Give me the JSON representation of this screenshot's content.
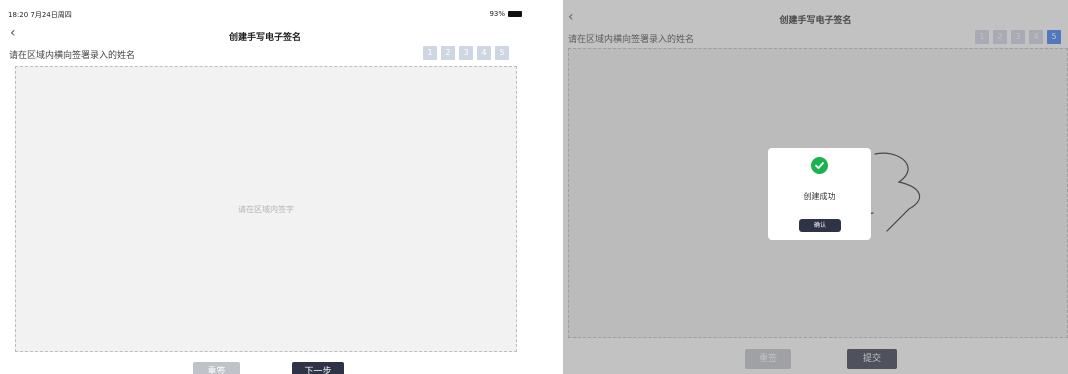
{
  "left": {
    "status_time": "18:20  7月24日周四",
    "battery_pct": "93%",
    "back_icon": "chevron-left-icon",
    "title": "创建手写电子签名",
    "instruction": "请在区域内横向签署录入的姓名",
    "steps": [
      "1",
      "2",
      "3",
      "4",
      "5"
    ],
    "active_step": 1,
    "pad_hint": "请在区域内签字",
    "reset_label": "重签",
    "next_label": "下一步"
  },
  "right": {
    "back_icon": "chevron-left-icon",
    "title": "创建手写电子签名",
    "instruction": "请在区域内横向签署录入的姓名",
    "steps": [
      "1",
      "2",
      "3",
      "4",
      "5"
    ],
    "active_step": 5,
    "modal": {
      "icon": "check-circle-icon",
      "message": "创建成功",
      "confirm_label": "确认"
    },
    "reset_label": "重签",
    "submit_label": "提交"
  },
  "colors": {
    "accent": "#2f7bf5",
    "step_inactive": "#cfd6e3",
    "dark_button": "#2e3446",
    "success": "#1bb34f"
  }
}
